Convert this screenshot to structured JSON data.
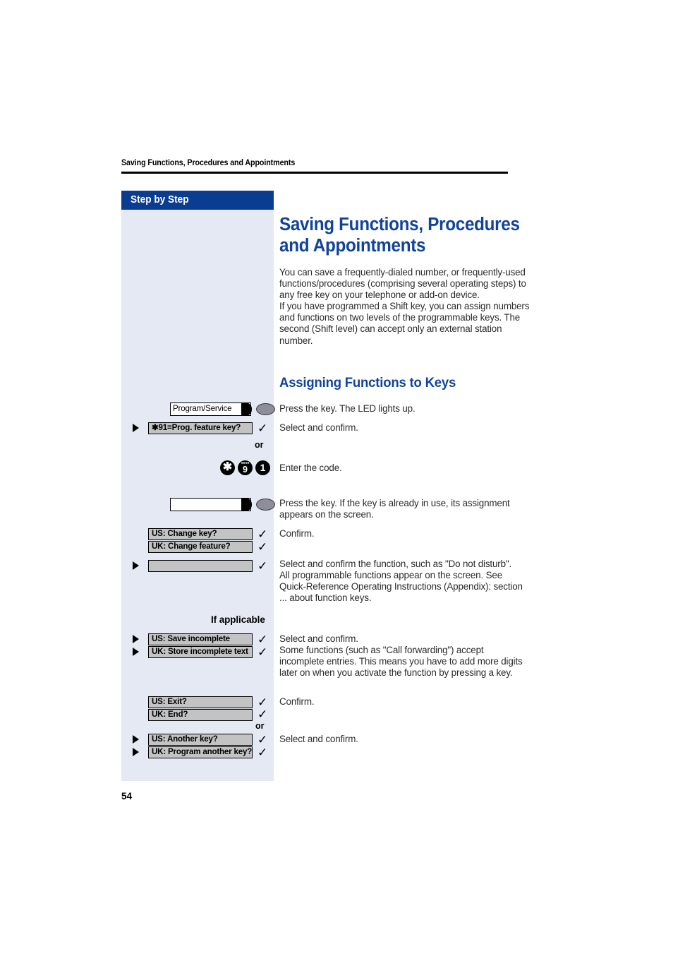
{
  "header": {
    "running_title": "Saving Functions, Procedures and Appointments"
  },
  "sidebar": {
    "title": "Step by Step",
    "or_1": "or",
    "or_2": "or",
    "if_applicable": "If applicable",
    "rows": {
      "program_service_key": "Program/Service",
      "prog_feature_key": "✱91=Prog. feature key?",
      "blank_key": "",
      "us_change_key": "US: Change key?",
      "uk_change_feature": "UK: Change feature?",
      "blank_option": "",
      "us_save_incomplete": "US: Save incomplete",
      "uk_store_incomplete": "UK: Store incomplete text",
      "us_exit": "US: Exit?",
      "uk_end": "UK: End?",
      "us_another_key": "US: Another key?",
      "uk_program_another_key": "UK: Program another key?"
    },
    "dial_keys": [
      {
        "glyph": "✱",
        "letters": ""
      },
      {
        "glyph": "9",
        "letters": "WXYZ"
      },
      {
        "glyph": "1",
        "letters": ""
      }
    ],
    "checkmark": "✓"
  },
  "main": {
    "title": "Saving Functions, Procedures and Appointments",
    "intro": "You can save a frequently-dialed number, or frequently-used functions/procedures (comprising several operating steps) to any free key on your telephone or add-on device.\nIf you have programmed a Shift key, you can assign numbers and functions on two levels of the programmable keys. The second (Shift level) can accept only an external station number.",
    "section_title": "Assigning Functions to Keys",
    "instructions": {
      "press_key_led": "Press the key. The LED lights up.",
      "select_confirm_1": "Select and confirm.",
      "enter_code": "Enter the code.",
      "press_key_assignment": "Press the key. If the key is already in use, its assignment appears on the screen.",
      "confirm_1": "Confirm.",
      "select_confirm_function": "Select and confirm the function, such as \"Do not disturb\".\nAll programmable functions appear on the screen. See Quick-Reference Operating Instructions (Appendix): section ... about function keys.",
      "select_confirm_incomplete": "Select and confirm.\nSome functions (such as \"Call forwarding\") accept incomplete entries. This means you have to add more digits later on when you activate the function by pressing a key.",
      "confirm_2": "Confirm.",
      "select_confirm_2": "Select and confirm."
    }
  },
  "footer": {
    "page_number": "54"
  },
  "colors": {
    "accent_blue": "#10439b",
    "bar_blue": "#0a3c91",
    "sidebar_bg": "#e4e9f4",
    "option_gray": "#c3c3c3"
  }
}
